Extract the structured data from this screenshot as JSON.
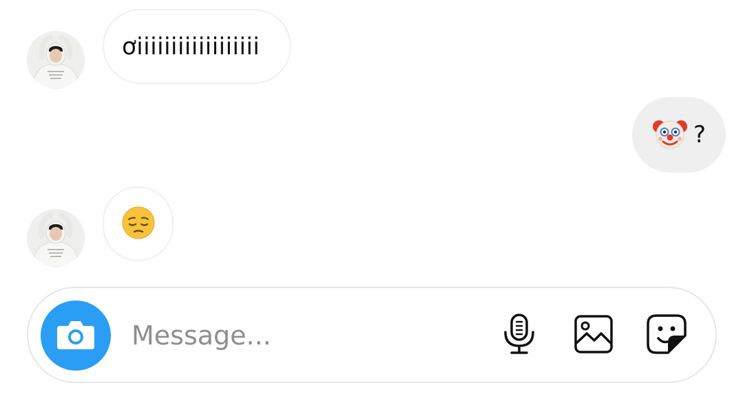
{
  "conversation": {
    "messages": [
      {
        "sender": "other",
        "text": "ơiiiiiiiiiiiiiiiiii"
      },
      {
        "sender": "me",
        "emoji": "clown-face",
        "text": "?"
      },
      {
        "sender": "other",
        "emoji": "pensive-face"
      }
    ]
  },
  "composer": {
    "placeholder": "Message...",
    "value": "",
    "icons": [
      "camera-icon",
      "microphone-icon",
      "gallery-icon",
      "sticker-icon"
    ]
  },
  "colors": {
    "accent": "#2a9df4",
    "incoming_border": "#efefef",
    "outgoing_bg": "#efefef"
  }
}
